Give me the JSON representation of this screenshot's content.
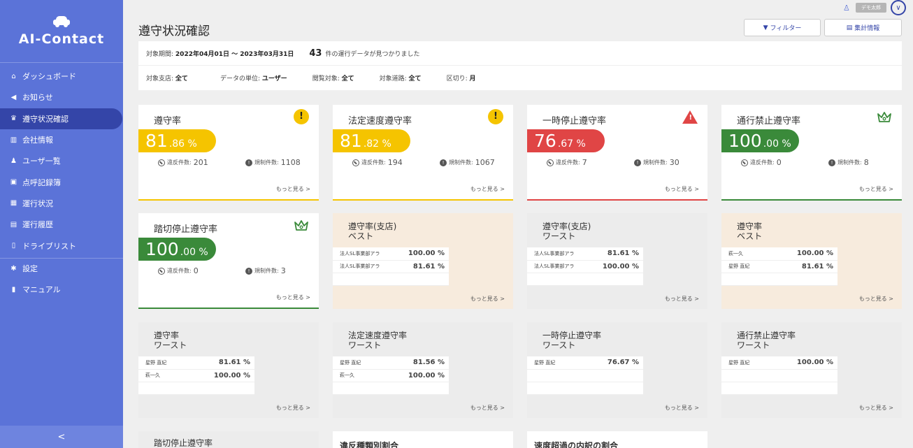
{
  "app": {
    "logo_text": "AI-Contact",
    "logo_icon": "car-icon"
  },
  "sidebar": {
    "items": [
      {
        "label": "ダッシュボード",
        "icon": "home-icon",
        "glyph": "⌂"
      },
      {
        "label": "お知らせ",
        "icon": "megaphone-icon",
        "glyph": "◀"
      },
      {
        "label": "遵守状況確認",
        "icon": "trophy-icon",
        "glyph": "♛"
      },
      {
        "label": "会社情報",
        "icon": "building-icon",
        "glyph": "▥"
      },
      {
        "label": "ユーザ一覧",
        "icon": "user-icon",
        "glyph": "♟"
      },
      {
        "label": "点呼記録簿",
        "icon": "clipboard-icon",
        "glyph": "▣"
      },
      {
        "label": "運行状況",
        "icon": "map-icon",
        "glyph": "▦"
      },
      {
        "label": "運行履歴",
        "icon": "list-icon",
        "glyph": "▤"
      },
      {
        "label": "ドライブリスト",
        "icon": "document-icon",
        "glyph": "▯"
      },
      {
        "label": "設定",
        "icon": "gear-icon",
        "glyph": "✱"
      },
      {
        "label": "マニュアル",
        "icon": "book-icon",
        "glyph": "▮"
      }
    ],
    "collapse_label": "<"
  },
  "header": {
    "user_name": "デモ太郎",
    "page_title": "遵守状況確認",
    "filter_label": "フィルター",
    "summary_label": "集計情報"
  },
  "info": {
    "period_label": "対象期間:",
    "period_value": "2022年04月01日 〜 2023年03月31日",
    "count": "43",
    "count_suffix": "件の運行データが見つかりました",
    "branch_label": "対象支店:",
    "branch_value": "全て",
    "unit_label": "データの単位:",
    "unit_value": "ユーザー",
    "view_label": "閲覧対象:",
    "view_value": "全て",
    "road_label": "対象道路:",
    "road_value": "全て",
    "interval_label": "区切り:",
    "interval_value": "月"
  },
  "common": {
    "violation_label": "違反件数:",
    "regulation_label": "規制件数:",
    "more_label": "もっと見る >"
  },
  "cards": [
    {
      "title": "遵守率",
      "int": "81",
      "dec": ".86 %",
      "violations": "201",
      "regulations": "1108",
      "color": "#f5c400",
      "status": "warning-icon"
    },
    {
      "title": "法定速度遵守率",
      "int": "81",
      "dec": ".82 %",
      "violations": "194",
      "regulations": "1067",
      "color": "#f5c400",
      "status": "warning-icon"
    },
    {
      "title": "一時停止遵守率",
      "int": "76",
      "dec": ".67 %",
      "violations": "7",
      "regulations": "30",
      "color": "#e04545",
      "status": "alert-triangle-icon"
    },
    {
      "title": "通行禁止遵守率",
      "int": "100",
      "dec": ".00 %",
      "violations": "0",
      "regulations": "8",
      "color": "#3a8a3a",
      "status": "crown-icon"
    },
    {
      "title": "踏切停止遵守率",
      "int": "100",
      "dec": ".00 %",
      "violations": "0",
      "regulations": "3",
      "color": "#3a8a3a",
      "status": "crown-icon"
    }
  ],
  "rankings": [
    {
      "title1": "遵守率(支店)",
      "title2": "ベスト",
      "bg": "peach",
      "rows": [
        [
          "法人SL事業部アラ",
          "100.00 %",
          "g"
        ],
        [
          "法人SL事業部アラ",
          "81.61 %",
          "y"
        ]
      ]
    },
    {
      "title1": "遵守率(支店)",
      "title2": "ワースト",
      "bg": "gray",
      "rows": [
        [
          "法人SL事業部アラ",
          "81.61 %",
          "y"
        ],
        [
          "法人SL事業部アラ",
          "100.00 %",
          "g"
        ]
      ]
    },
    {
      "title1": "遵守率",
      "title2": "ベスト",
      "bg": "peach",
      "rows": [
        [
          "萩一久",
          "100.00 %",
          "g"
        ],
        [
          "星野 直紀",
          "81.61 %",
          "y"
        ]
      ]
    },
    {
      "title1": "遵守率",
      "title2": "ワースト",
      "bg": "gray",
      "rows": [
        [
          "星野 直紀",
          "81.61 %",
          "y"
        ],
        [
          "萩一久",
          "100.00 %",
          "g"
        ]
      ]
    },
    {
      "title1": "法定速度遵守率",
      "title2": "ワースト",
      "bg": "gray",
      "rows": [
        [
          "星野 直紀",
          "81.56 %",
          "y"
        ],
        [
          "萩一久",
          "100.00 %",
          "g"
        ]
      ]
    },
    {
      "title1": "一時停止遵守率",
      "title2": "ワースト",
      "bg": "gray",
      "rows": [
        [
          "星野 直紀",
          "76.67 %",
          "r"
        ]
      ]
    },
    {
      "title1": "通行禁止遵守率",
      "title2": "ワースト",
      "bg": "gray",
      "rows": [
        [
          "星野 直紀",
          "100.00 %",
          "g"
        ]
      ]
    }
  ],
  "bottom": [
    "踏切停止遵守率",
    "違反種類別割合",
    "速度超過の内訳の割合"
  ]
}
